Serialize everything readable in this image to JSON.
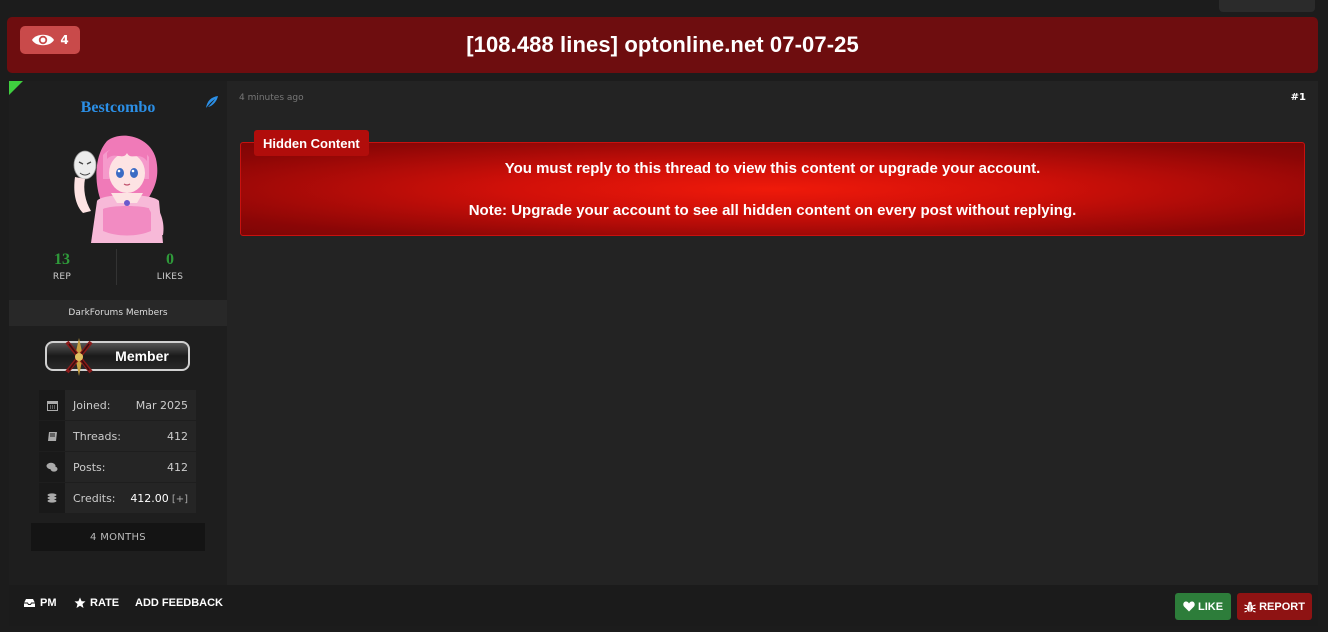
{
  "thread": {
    "title": "[108.488 lines] optonline.net 07-07-25",
    "views": "4"
  },
  "post": {
    "time": "4 minutes ago",
    "number": "#1",
    "author": {
      "username": "Bestcombo",
      "rep_value": "13",
      "rep_label": "REP",
      "likes_value": "0",
      "likes_label": "LIKES",
      "group": "DarkForums Members",
      "badge_label": "Member",
      "joined_label": "Joined:",
      "joined_value": "Mar 2025",
      "threads_label": "Threads:",
      "threads_value": "412",
      "posts_label": "Posts:",
      "posts_value": "412",
      "credits_label": "Credits:",
      "credits_value": "412.00",
      "credits_plus": "[+]",
      "duration": "4 MONTHS"
    },
    "hidden": {
      "tag": "Hidden Content",
      "message": "You must reply to this thread to view this content or upgrade your account.",
      "note": "Note: Upgrade your account to see all hidden content on every post without replying."
    }
  },
  "footer": {
    "pm": "PM",
    "rate": "RATE",
    "feedback": "ADD FEEDBACK",
    "like": "LIKE",
    "report": "REPORT"
  },
  "icons": {
    "views": "eye-icon",
    "feather": "feather-icon",
    "joined": "calendar-icon",
    "threads": "book-icon",
    "posts": "comments-icon",
    "credits": "coins-icon",
    "pm": "inbox-icon",
    "rate": "star-icon",
    "like": "heart-icon",
    "report": "bug-icon"
  },
  "colors": {
    "header": "#6e0d0f",
    "username": "#2b8fe6",
    "stat_value": "#2f9a3a",
    "like_button": "#2d7d3a",
    "report_button": "#8e1313",
    "hidden_box": "#d11009"
  }
}
